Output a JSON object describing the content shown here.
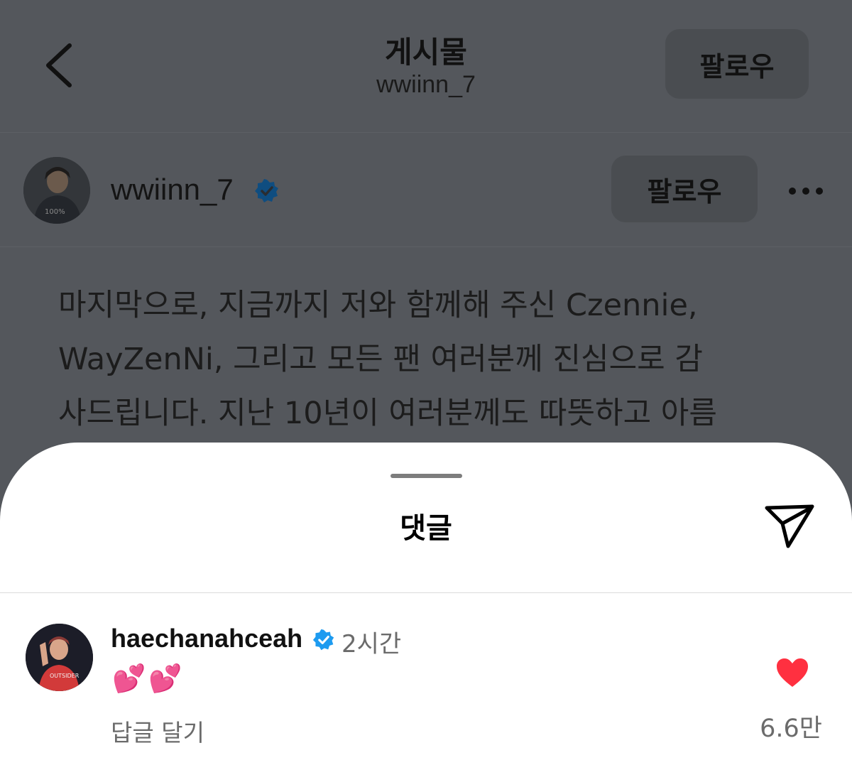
{
  "header": {
    "title": "게시물",
    "subtitle": "wwiinn_7",
    "follow_label": "팔로우"
  },
  "author": {
    "username": "wwiinn_7",
    "follow_label": "팔로우"
  },
  "caption": {
    "lines": [
      "마지막으로, 지금까지 저와 함께해 주신 Czennie,",
      "WayZenNi, 그리고 모든 팬 여러분께 진심으로 감",
      "사드립니다. 지난 10년이 여러분께도 따뜻하고 아름"
    ]
  },
  "sheet": {
    "title": "댓글"
  },
  "comment": {
    "username": "haechanahceah",
    "time": "2시간",
    "body": "💕💕",
    "reply_label": "답글 달기",
    "like_count": "6.6만"
  },
  "colors": {
    "verified": "#1d9bf0",
    "heart": "#ff3040",
    "overlay": "#54575c"
  },
  "icons": {
    "back": "chevron-left-icon",
    "verified": "verified-badge-icon",
    "more": "more-horizontal-icon",
    "share": "send-icon",
    "like": "heart-filled-icon"
  }
}
